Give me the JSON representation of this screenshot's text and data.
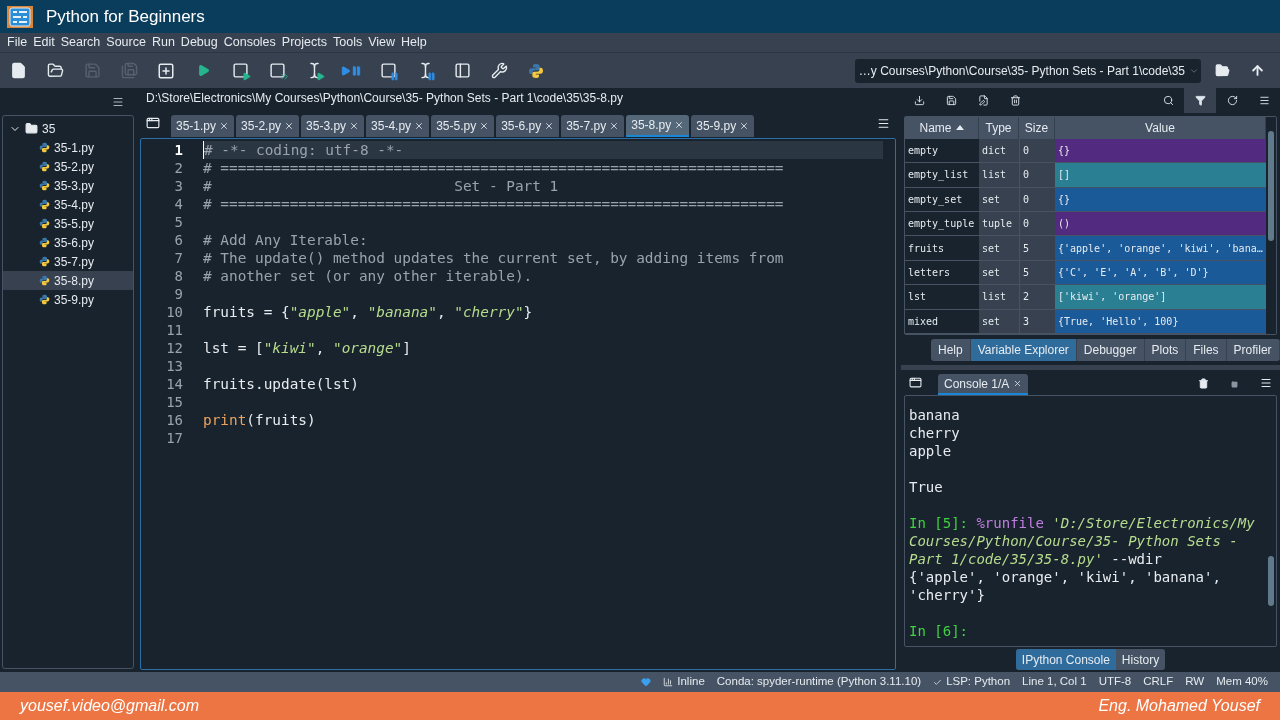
{
  "window": {
    "title": "Python for Beginners"
  },
  "menu": [
    "File",
    "Edit",
    "Search",
    "Source",
    "Run",
    "Debug",
    "Consoles",
    "Projects",
    "Tools",
    "View",
    "Help"
  ],
  "toolbar": [
    {
      "kind": "new-file",
      "disabled": false
    },
    {
      "kind": "open",
      "disabled": false
    },
    {
      "kind": "save",
      "disabled": true
    },
    {
      "kind": "save-all",
      "disabled": true
    },
    {
      "kind": "new-cell",
      "disabled": false
    },
    {
      "kind": "run",
      "disabled": false
    },
    {
      "kind": "run-cell",
      "disabled": false
    },
    {
      "kind": "run-cell-advance",
      "disabled": false
    },
    {
      "kind": "run-selection",
      "disabled": false
    },
    {
      "kind": "debug",
      "disabled": false
    },
    {
      "kind": "debug-cell",
      "disabled": false
    },
    {
      "kind": "debug-selection",
      "disabled": false
    },
    {
      "kind": "maximize",
      "disabled": false
    },
    {
      "kind": "preferences",
      "disabled": false
    },
    {
      "kind": "python-path",
      "disabled": false
    }
  ],
  "working_directory": "…y Courses\\Python\\Course\\35- Python Sets - Part 1\\code\\35",
  "file_tree": [
    {
      "label": "35",
      "expanded": true,
      "selected": false,
      "children": [
        {
          "label": "35-1.py",
          "selected": false
        },
        {
          "label": "35-2.py",
          "selected": false
        },
        {
          "label": "35-3.py",
          "selected": false
        },
        {
          "label": "35-4.py",
          "selected": false
        },
        {
          "label": "35-5.py",
          "selected": false
        },
        {
          "label": "35-6.py",
          "selected": false
        },
        {
          "label": "35-7.py",
          "selected": false
        },
        {
          "label": "35-8.py",
          "selected": true
        },
        {
          "label": "35-9.py",
          "selected": false
        }
      ]
    }
  ],
  "editor": {
    "path": "D:\\Store\\Electronics\\My Courses\\Python\\Course\\35- Python Sets - Part 1\\code\\35\\35-8.py",
    "tabs": [
      {
        "label": "35-1.py",
        "selected": false
      },
      {
        "label": "35-2.py",
        "selected": false
      },
      {
        "label": "35-3.py",
        "selected": false
      },
      {
        "label": "35-4.py",
        "selected": false
      },
      {
        "label": "35-5.py",
        "selected": false
      },
      {
        "label": "35-6.py",
        "selected": false
      },
      {
        "label": "35-7.py",
        "selected": false
      },
      {
        "label": "35-8.py",
        "selected": true
      },
      {
        "label": "35-9.py",
        "selected": false
      }
    ],
    "lines": [
      {
        "number": "1",
        "current": true,
        "segments": [
          {
            "kind": "comment",
            "text": "# -*- coding: utf-8 -*-"
          }
        ]
      },
      {
        "number": "2",
        "current": false,
        "segments": [
          {
            "kind": "comment",
            "text": "# ================================================================="
          }
        ]
      },
      {
        "number": "3",
        "current": false,
        "segments": [
          {
            "kind": "comment",
            "text": "#                            Set - Part 1"
          }
        ]
      },
      {
        "number": "4",
        "current": false,
        "segments": [
          {
            "kind": "comment",
            "text": "# ================================================================="
          }
        ]
      },
      {
        "number": "5",
        "current": false
      },
      {
        "number": "6",
        "current": false,
        "segments": [
          {
            "kind": "comment",
            "text": "# Add Any Iterable:"
          }
        ]
      },
      {
        "number": "7",
        "current": false,
        "segments": [
          {
            "kind": "comment",
            "text": "# The update() method updates the current set, by adding items from"
          }
        ]
      },
      {
        "number": "8",
        "current": false,
        "segments": [
          {
            "kind": "comment",
            "text": "# another set (or any other iterable)."
          }
        ]
      },
      {
        "number": "9",
        "current": false
      },
      {
        "number": "10",
        "current": false,
        "segments": [
          {
            "kind": "plain",
            "text": "fruits = {"
          },
          {
            "kind": "string",
            "text": "\"apple\""
          },
          {
            "kind": "plain",
            "text": ", "
          },
          {
            "kind": "string",
            "text": "\"banana\""
          },
          {
            "kind": "plain",
            "text": ", "
          },
          {
            "kind": "string",
            "text": "\"cherry\""
          },
          {
            "kind": "plain",
            "text": "}"
          }
        ]
      },
      {
        "number": "11",
        "current": false
      },
      {
        "number": "12",
        "current": false,
        "segments": [
          {
            "kind": "plain",
            "text": "lst = ["
          },
          {
            "kind": "string",
            "text": "\"kiwi\""
          },
          {
            "kind": "plain",
            "text": ", "
          },
          {
            "kind": "string",
            "text": "\"orange\""
          },
          {
            "kind": "plain",
            "text": "]"
          }
        ]
      },
      {
        "number": "13",
        "current": false
      },
      {
        "number": "14",
        "current": false,
        "segments": [
          {
            "kind": "plain",
            "text": "fruits.update(lst)"
          }
        ]
      },
      {
        "number": "15",
        "current": false
      },
      {
        "number": "16",
        "current": false,
        "segments": [
          {
            "kind": "builtin",
            "text": "print"
          },
          {
            "kind": "plain",
            "text": "(fruits)"
          }
        ]
      },
      {
        "number": "17",
        "current": false
      }
    ]
  },
  "variable_explorer": {
    "toolbar": [
      {
        "kind": "import",
        "selected": false
      },
      {
        "kind": "save",
        "selected": false
      },
      {
        "kind": "save-as",
        "selected": false
      },
      {
        "kind": "delete",
        "selected": false
      },
      {
        "kind": "search",
        "selected": false
      },
      {
        "kind": "filter",
        "selected": true
      },
      {
        "kind": "refresh",
        "selected": false
      },
      {
        "kind": "menu",
        "selected": false
      }
    ],
    "columns": [
      "Name",
      "Type",
      "Size",
      "Value"
    ],
    "rows": [
      {
        "name": "empty",
        "type": "dict",
        "size": "0",
        "value": "{}",
        "color": "#522a80"
      },
      {
        "name": "empty_list",
        "type": "list",
        "size": "0",
        "value": "[]",
        "color": "#2a7f92"
      },
      {
        "name": "empty_set",
        "type": "set",
        "size": "0",
        "value": "{}",
        "color": "#1a5a98"
      },
      {
        "name": "empty_tuple",
        "type": "tuple",
        "size": "0",
        "value": "()",
        "color": "#522a80"
      },
      {
        "name": "fruits",
        "type": "set",
        "size": "5",
        "value": "{'apple', 'orange', 'kiwi', 'bana…",
        "color": "#1a5a98"
      },
      {
        "name": "letters",
        "type": "set",
        "size": "5",
        "value": "{'C', 'E', 'A', 'B', 'D'}",
        "color": "#1a5a98"
      },
      {
        "name": "lst",
        "type": "list",
        "size": "2",
        "value": "['kiwi', 'orange']",
        "color": "#2a7f92"
      },
      {
        "name": "mixed",
        "type": "set",
        "size": "3",
        "value": "{True, 'Hello', 100}",
        "color": "#1a5a98"
      }
    ]
  },
  "top_pane_tabs": [
    {
      "label": "Help",
      "selected": false
    },
    {
      "label": "Variable Explorer",
      "selected": true
    },
    {
      "label": "Debugger",
      "selected": false
    },
    {
      "label": "Plots",
      "selected": false
    },
    {
      "label": "Files",
      "selected": false
    },
    {
      "label": "Profiler",
      "selected": false
    }
  ],
  "console": {
    "tab": {
      "label": "Console 1/A",
      "selected": true
    },
    "lines": [
      {
        "kind": "text",
        "segments": [
          {
            "kind": "plain",
            "text": "banana"
          }
        ]
      },
      {
        "kind": "text",
        "segments": [
          {
            "kind": "plain",
            "text": "cherry"
          }
        ]
      },
      {
        "kind": "text",
        "segments": [
          {
            "kind": "plain",
            "text": "apple"
          }
        ]
      },
      {
        "kind": "blank"
      },
      {
        "kind": "text",
        "segments": [
          {
            "kind": "plain",
            "text": "True"
          }
        ]
      },
      {
        "kind": "blank"
      },
      {
        "kind": "text",
        "segments": [
          {
            "kind": "prompt",
            "text": "In [5]: "
          },
          {
            "kind": "magic",
            "text": "%runfile"
          },
          {
            "kind": "string",
            "text": " 'D:/Store/Electronics/My"
          }
        ]
      },
      {
        "kind": "text",
        "segments": [
          {
            "kind": "string",
            "text": "Courses/Python/Course/35- Python Sets -"
          }
        ]
      },
      {
        "kind": "text",
        "segments": [
          {
            "kind": "string",
            "text": "Part 1/code/35/35-8.py'"
          },
          {
            "kind": "plain",
            "text": " --wdir"
          }
        ]
      },
      {
        "kind": "text",
        "segments": [
          {
            "kind": "plain",
            "text": "{'apple', 'orange', 'kiwi', 'banana',"
          }
        ]
      },
      {
        "kind": "text",
        "segments": [
          {
            "kind": "plain",
            "text": "'cherry'}"
          }
        ]
      },
      {
        "kind": "blank"
      },
      {
        "kind": "text",
        "segments": [
          {
            "kind": "prompt",
            "text": "In [6]:"
          }
        ]
      }
    ]
  },
  "bottom_pane_tabs": [
    {
      "label": "IPython Console",
      "selected": true
    },
    {
      "label": "History",
      "selected": false
    }
  ],
  "status_bar": [
    {
      "kind": "heart"
    },
    {
      "kind": "chart",
      "text": "Inline"
    },
    {
      "kind": "text",
      "text": "Conda: spyder-runtime (Python 3.11.10)"
    },
    {
      "kind": "check",
      "text": "LSP: Python"
    },
    {
      "kind": "text",
      "text": "Line 1, Col 1"
    },
    {
      "kind": "text",
      "text": "UTF-8"
    },
    {
      "kind": "text",
      "text": "CRLF"
    },
    {
      "kind": "text",
      "text": "RW"
    },
    {
      "kind": "text",
      "text": "Mem 40%"
    }
  ],
  "banner": {
    "left": "yousef.video@gmail.com",
    "right": "Eng. Mohamed Yousef"
  }
}
